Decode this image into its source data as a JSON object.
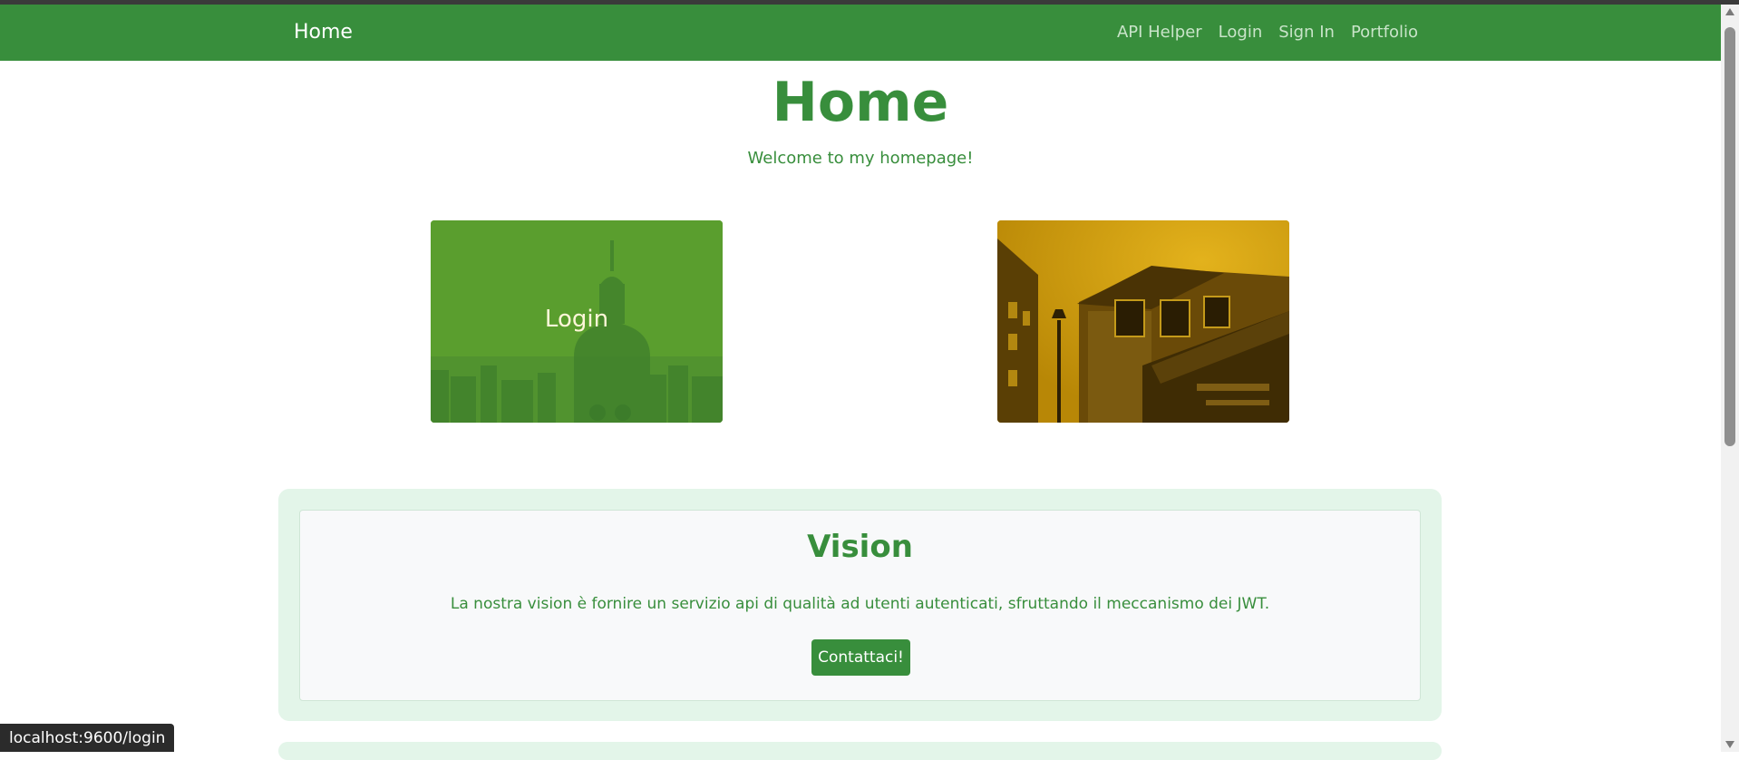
{
  "navbar": {
    "brand": "Home",
    "links": [
      {
        "label": "API Helper"
      },
      {
        "label": "Login"
      },
      {
        "label": "Sign In"
      },
      {
        "label": "Portfolio"
      }
    ]
  },
  "header": {
    "title": "Home",
    "subtitle": "Welcome to my homepage!"
  },
  "cards": {
    "login_label": "Login"
  },
  "vision": {
    "title": "Vision",
    "text": "La nostra vision è fornire un servizio api di qualità ad utenti autenticati, sfruttando il meccanismo dei JWT.",
    "button_label": "Contattaci!"
  },
  "statusbar": {
    "url": "localhost:9600/login"
  },
  "colors": {
    "primary": "#388e3c",
    "vision_bg": "#e3f5e9",
    "login_card": "#5a9e2e",
    "building_card": "#c79b0e"
  }
}
